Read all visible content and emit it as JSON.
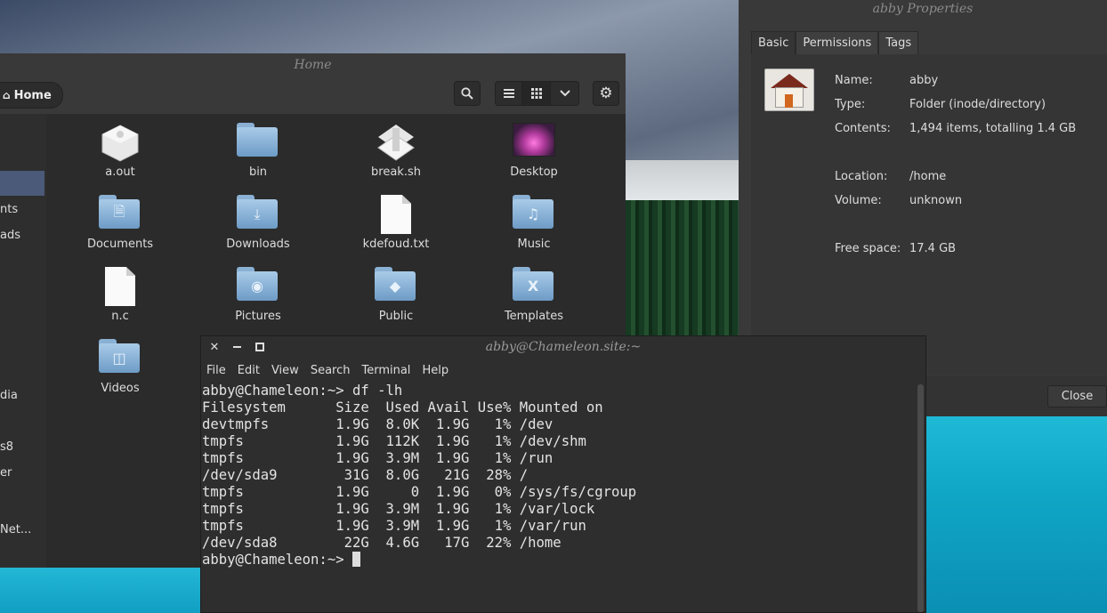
{
  "file_manager": {
    "title": "Home",
    "path_button": "Home",
    "sidebar": [
      {
        "label": ""
      },
      {
        "label": "nts"
      },
      {
        "label": "ads"
      },
      {
        "label": "dia"
      },
      {
        "label": "s8"
      },
      {
        "label": "er"
      },
      {
        "label": "Net..."
      }
    ],
    "files": [
      {
        "name": "a.out",
        "icon": "package-icon"
      },
      {
        "name": "bin",
        "icon": "folder-icon"
      },
      {
        "name": "break.sh",
        "icon": "script-icon"
      },
      {
        "name": "Desktop",
        "icon": "desktop-folder-icon"
      },
      {
        "name": "Documents",
        "icon": "documents-folder-icon"
      },
      {
        "name": "Downloads",
        "icon": "downloads-folder-icon"
      },
      {
        "name": "kdefoud.txt",
        "icon": "text-file-icon"
      },
      {
        "name": "Music",
        "icon": "music-folder-icon"
      },
      {
        "name": "n.c",
        "icon": "text-file-icon"
      },
      {
        "name": "Pictures",
        "icon": "pictures-folder-icon"
      },
      {
        "name": "Public",
        "icon": "public-folder-icon"
      },
      {
        "name": "Templates",
        "icon": "templates-folder-icon"
      },
      {
        "name": "Videos",
        "icon": "videos-folder-icon"
      }
    ]
  },
  "properties": {
    "title": "abby Properties",
    "tabs": [
      "Basic",
      "Permissions",
      "Tags"
    ],
    "name_label": "Name:",
    "name_value": "abby",
    "type_label": "Type:",
    "type_value": "Folder (inode/directory)",
    "contents_label": "Contents:",
    "contents_value": "1,494 items, totalling 1.4 GB",
    "location_label": "Location:",
    "location_value": "/home",
    "volume_label": "Volume:",
    "volume_value": "unknown",
    "free_label": "Free space:",
    "free_value": "17.4 GB",
    "close_label": "Close"
  },
  "terminal": {
    "title": "abby@Chameleon.site:~",
    "menu": [
      "File",
      "Edit",
      "View",
      "Search",
      "Terminal",
      "Help"
    ],
    "lines": [
      "abby@Chameleon:~> df -lh",
      "Filesystem      Size  Used Avail Use% Mounted on",
      "devtmpfs        1.9G  8.0K  1.9G   1% /dev",
      "tmpfs           1.9G  112K  1.9G   1% /dev/shm",
      "tmpfs           1.9G  3.9M  1.9G   1% /run",
      "/dev/sda9        31G  8.0G   21G  28% /",
      "tmpfs           1.9G     0  1.9G   0% /sys/fs/cgroup",
      "tmpfs           1.9G  3.9M  1.9G   1% /var/lock",
      "tmpfs           1.9G  3.9M  1.9G   1% /var/run",
      "/dev/sda8        22G  4.6G   17G  22% /home"
    ],
    "prompt": "abby@Chameleon:~> "
  }
}
